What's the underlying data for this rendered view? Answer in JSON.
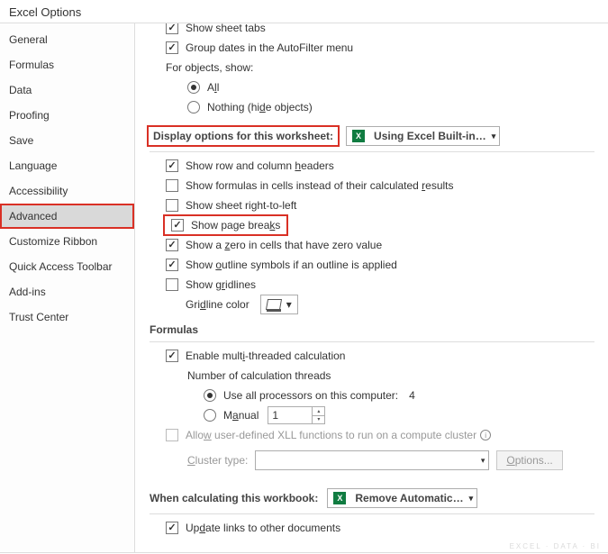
{
  "title": "Excel Options",
  "sidebar": {
    "items": [
      {
        "label": "General"
      },
      {
        "label": "Formulas"
      },
      {
        "label": "Data"
      },
      {
        "label": "Proofing"
      },
      {
        "label": "Save"
      },
      {
        "label": "Language"
      },
      {
        "label": "Accessibility"
      },
      {
        "label": "Advanced",
        "selected": true
      },
      {
        "label": "Customize Ribbon"
      },
      {
        "label": "Quick Access Toolbar"
      },
      {
        "label": "Add-ins"
      },
      {
        "label": "Trust Center"
      }
    ]
  },
  "top_partial": {
    "show_sheet_tabs": "Show sheet tabs",
    "group_dates": "Group dates in the AutoFilter menu",
    "for_objects": "For objects, show:",
    "opt_all_pre": "A",
    "opt_all_ul": "l",
    "opt_all_post": "l",
    "opt_nothing_pre": "Nothing (hi",
    "opt_nothing_ul": "d",
    "opt_nothing_post": "e objects)"
  },
  "worksheet_section": {
    "heading": "Display options for this worksheet:",
    "dropdown": "Using Excel Built-in…",
    "show_headers_pre": "Show row and column ",
    "show_headers_ul": "h",
    "show_headers_post": "eaders",
    "show_formulas_pre": "Show formulas in cells instead of their calculated ",
    "show_formulas_ul": "r",
    "show_formulas_post": "esults",
    "show_rtl": "Show sheet right-to-left",
    "show_page_breaks_pre": "Show page brea",
    "show_page_breaks_ul": "k",
    "show_page_breaks_post": "s",
    "show_zero_pre": "Show a ",
    "show_zero_ul": "z",
    "show_zero_post": "ero in cells that have zero value",
    "show_outline_pre": "Show ",
    "show_outline_ul": "o",
    "show_outline_post": "utline symbols if an outline is applied",
    "show_gridlines_pre": "Show g",
    "show_gridlines_ul": "r",
    "show_gridlines_post": "idlines",
    "gridline_label_pre": "Gri",
    "gridline_label_ul": "d",
    "gridline_label_post": "line color"
  },
  "formulas_section": {
    "heading": "Formulas",
    "enable_pre": "Enable mult",
    "enable_ul": "i",
    "enable_post": "-threaded calculation",
    "threads_label": "Number of calculation threads",
    "all_proc": "Use all processors on this computer:",
    "all_proc_count": "4",
    "manual_pre": "M",
    "manual_ul": "a",
    "manual_post": "nual",
    "manual_value": "1",
    "allow_xll_pre": "Allo",
    "allow_xll_ul": "w",
    "allow_xll_post": " user-defined XLL functions to run on a compute cluster",
    "cluster_pre": "",
    "cluster_ul": "C",
    "cluster_post": "luster type:",
    "options_btn_pre": "",
    "options_btn_ul": "O",
    "options_btn_post": "ptions..."
  },
  "workbook_section": {
    "heading": "When calculating this workbook:",
    "dropdown": "Remove Automatic…",
    "update_links_pre": "Up",
    "update_links_ul": "d",
    "update_links_post": "ate links to other documents"
  },
  "watermark": "EXCEL · DATA · BI"
}
